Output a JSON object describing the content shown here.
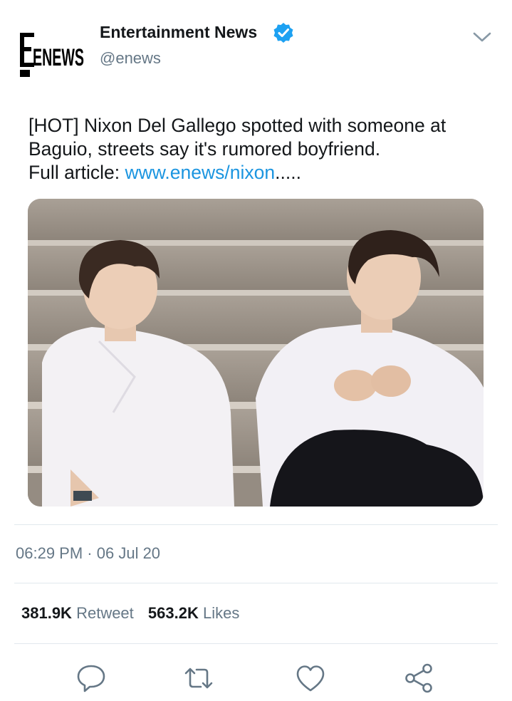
{
  "author": {
    "logo_text": "ENEWS",
    "name": "Entertainment News",
    "handle": "@enews",
    "verified": true
  },
  "tweet": {
    "text_line1": "[HOT] Nixon Del Gallego spotted with someone at",
    "text_line2": "Baguio, streets say it's rumored boyfriend.",
    "full_article_label": "Full article: ",
    "link_text": "www.enews/nixon",
    "link_suffix": ".....",
    "link_color": "#1b95e0"
  },
  "meta": {
    "time": "06:29 PM",
    "separator": "·",
    "date": "06 Jul 20"
  },
  "stats": {
    "retweets_count": "381.9K",
    "retweets_label": "Retweet",
    "likes_count": "563.2K",
    "likes_label": "Likes"
  },
  "icons": {
    "reply": "reply-icon",
    "retweet": "retweet-icon",
    "like": "heart-icon",
    "share": "share-icon",
    "menu": "chevron-down-icon",
    "verified": "verified-badge-icon"
  },
  "colors": {
    "text": "#14171a",
    "secondary": "#657786",
    "verified": "#1da1f2",
    "divider": "#e1e8ed"
  }
}
